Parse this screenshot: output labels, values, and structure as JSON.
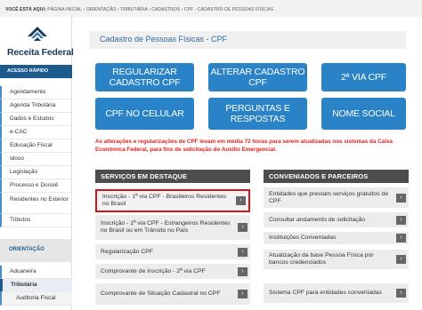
{
  "breadcrumb": {
    "here_label": "VOCÊ ESTÁ AQUI:",
    "path": "PÁGINA INICIAL › ORIENTAÇÃO › TRIBUTÁRIA › CADASTROS › CPF - CADASTRO DE PESSOAS FÍSICAS"
  },
  "brand": {
    "name": "Receita Federal",
    "color": "#1a3a5c"
  },
  "sidebar": {
    "section1": "ACESSO RÁPIDO",
    "items": [
      "Agendamento",
      "Agenda Tributária",
      "Dados e Estudos",
      "e-CAC",
      "Educação Fiscal",
      "Idoso",
      "Legislação",
      "Processo e Dossiê",
      "Residentes no Exterior",
      "Tributos"
    ],
    "section2": "ORIENTAÇÃO",
    "items2": [
      "Aduaneira",
      "Tributária",
      "Auditoria Fiscal"
    ]
  },
  "main": {
    "title": "Cadastro de Pessoas Físicas - CPF",
    "buttons": [
      "REGULARIZAR CADASTRO CPF",
      "ALTERAR CADASTRO CPF",
      "2ª VIA CPF",
      "CPF NO CELULAR",
      "PERGUNTAS E RESPOSTAS",
      "NOME SOCIAL"
    ],
    "notice": "As alterações e regularizações de CPF levam em média 72 horas para serem atualizadas nos sistemas da Caixa Econômica Federal, para fins de solicitação do Auxílio Emergencial.",
    "services_title": "SERVIÇOS EM DESTAQUE",
    "services": [
      "Inscrição - 1ª via CPF - Brasileiros Residentes no Brasil",
      "Inscrição - 1ª via CPF - Estrangeiros Residentes no Brasil ou em Trânsito no País",
      "Regularização CPF",
      "Comprovante de Inscrição - 2ª via CPF",
      "Comprovante de Situação Cadastral no CPF"
    ],
    "partners_title": "CONVENIADOS E PARCEIROS",
    "partners": [
      "Entidades que prestam serviços gratuitos de CPF",
      "Consultar andamento de solicitação",
      "Instituições Conveniadas",
      "Atualização da base Pessoa Física por bancos credenciados",
      "Sistema CPF para entidades conveniadas"
    ],
    "arrow_glyph": "›"
  },
  "colors": {
    "accent": "#2a82c7",
    "sidebar_header": "#1d5a8e",
    "notice": "#e02020",
    "highlight_border": "#d4141c",
    "panel_header": "#4d4d4d"
  }
}
